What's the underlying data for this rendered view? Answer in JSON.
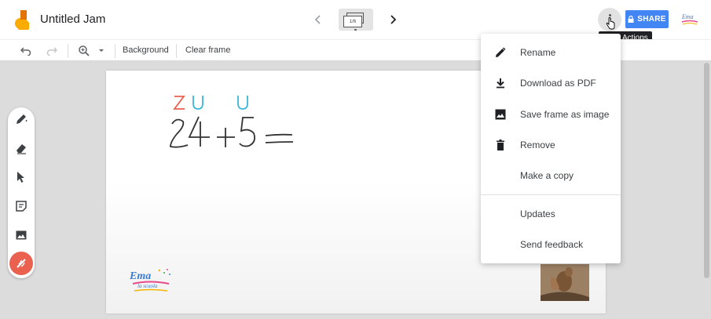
{
  "app": {
    "title": "Untitled Jam",
    "frame_indicator": "1/6",
    "tooltip": "More Actions",
    "share_label": "SHARE",
    "accent_color": "#4285f4"
  },
  "toolbar": {
    "background_label": "Background",
    "clear_frame_label": "Clear frame"
  },
  "canvas": {
    "handwriting_top": "ZU U",
    "handwriting_equation": "24+5="
  },
  "menu": {
    "items": [
      {
        "label": "Rename",
        "icon": "pencil-icon"
      },
      {
        "label": "Download as PDF",
        "icon": "download-icon"
      },
      {
        "label": "Save frame as image",
        "icon": "image-icon"
      },
      {
        "label": "Remove",
        "icon": "trash-icon"
      },
      {
        "label": "Make a copy",
        "icon": ""
      },
      {
        "label": "Updates",
        "icon": ""
      },
      {
        "label": "Send feedback",
        "icon": ""
      }
    ]
  },
  "watermark": {
    "line1": "Ema",
    "line2": "la scuola"
  }
}
